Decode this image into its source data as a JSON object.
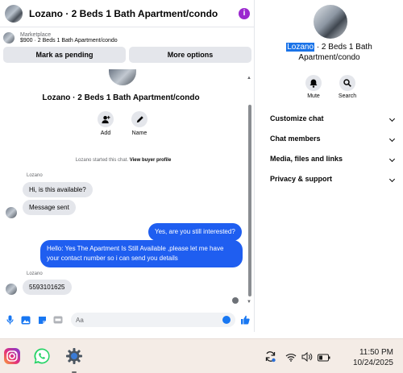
{
  "chat": {
    "title": "Lozano · 2 Beds 1 Bath Apartment/condo",
    "listing": {
      "category": "Marketplace",
      "price_line": "$900 · 2 Beds 1 Bath Apartment/condo",
      "mark_pending_label": "Mark as pending",
      "more_options_label": "More options"
    },
    "center_title": "Lozano · 2 Beds 1 Bath Apartment/condo",
    "actions": [
      {
        "label": "Add",
        "icon": "add-person-icon"
      },
      {
        "label": "Name",
        "icon": "pencil-icon"
      }
    ],
    "started_text": "Lozano started this chat.",
    "view_profile_label": "View buyer profile",
    "messages": [
      {
        "sender": "Lozano",
        "text": "Hi, is this available?",
        "direction": "in"
      },
      {
        "text": "Message sent",
        "direction": "in"
      },
      {
        "text": "Yes, are you still interested?",
        "direction": "out"
      },
      {
        "text": "Hello: Yes The Apartment Is Still Available ,please let me have your contact number so i can send you details",
        "direction": "out"
      },
      {
        "sender": "Lozano",
        "text": "5593101625",
        "direction": "in"
      }
    ],
    "composer": {
      "placeholder": "Aa",
      "icons": [
        "microphone-icon",
        "image-icon",
        "sticker-icon",
        "gif-icon",
        "emoji-icon",
        "thumbs-up-icon"
      ]
    }
  },
  "info": {
    "name_highlight": "Lozano",
    "name_rest": " · 2 Beds 1 Bath",
    "name_line2": "Apartment/condo",
    "actions": [
      {
        "label": "Mute",
        "icon": "bell-icon"
      },
      {
        "label": "Search",
        "icon": "search-icon"
      }
    ],
    "sections": [
      {
        "label": "Customize chat"
      },
      {
        "label": "Chat members"
      },
      {
        "label": "Media, files and links"
      },
      {
        "label": "Privacy & support"
      }
    ]
  },
  "taskbar": {
    "apps": [
      "instagram-icon",
      "whatsapp-icon",
      "settings-icon"
    ],
    "tray_icons": [
      "sync-icon",
      "wifi-icon",
      "volume-icon",
      "battery-icon"
    ],
    "time": "11:50 PM",
    "date": "10/24/2025"
  },
  "colors": {
    "accent": "#1f5ef0",
    "info_icon": "#9b27cf",
    "bubble_in": "#e4e6eb",
    "taskbar_bg": "#f4ece6"
  }
}
